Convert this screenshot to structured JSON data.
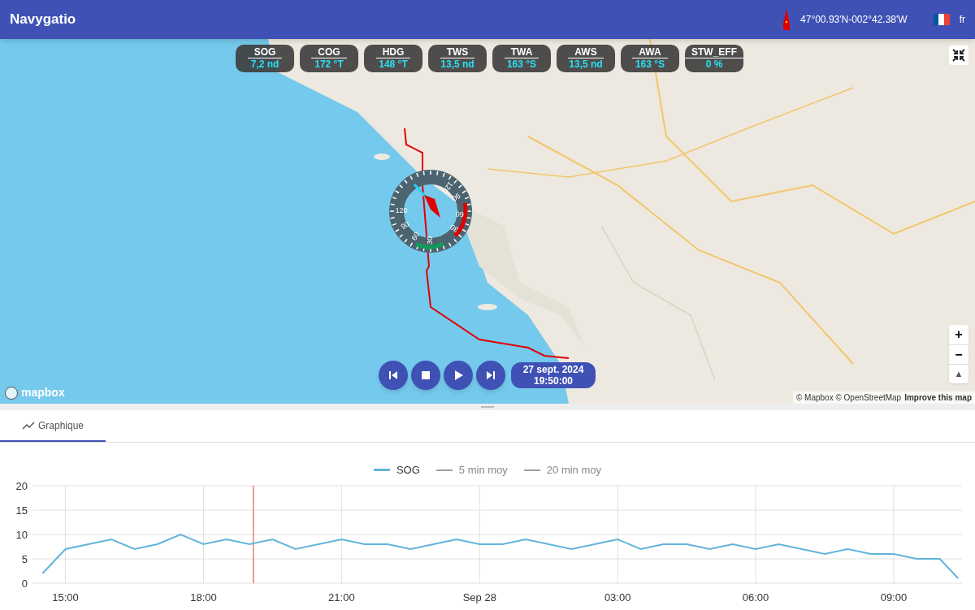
{
  "app_bar": {
    "title": "Navygatio",
    "position": "47°00.93'N-002°42.38'W",
    "language": "fr"
  },
  "instruments": [
    {
      "label": "SOG",
      "value": "7,2 nd"
    },
    {
      "label": "COG",
      "value": "172 °T"
    },
    {
      "label": "HDG",
      "value": "148 °T"
    },
    {
      "label": "TWS",
      "value": "13,5 nd"
    },
    {
      "label": "TWA",
      "value": "163 °S"
    },
    {
      "label": "AWS",
      "value": "13,5 nd"
    },
    {
      "label": "AWA",
      "value": "163 °S"
    },
    {
      "label": "STW_EFF",
      "value": "0 %"
    }
  ],
  "compass": {
    "labels": [
      "120",
      "90",
      "60",
      "30",
      "30",
      "60",
      "90",
      "120"
    ]
  },
  "map_controls": {
    "zoom_in": "+",
    "zoom_out": "−",
    "compass": "▲"
  },
  "playback": {
    "date": "27 sept. 2024",
    "time": "19:50:00"
  },
  "map_footer": {
    "logo": "mapbox",
    "attribution": "© Mapbox © OpenStreetMap",
    "improve": "Improve this map"
  },
  "tabs": [
    {
      "label": "Graphique",
      "selected": true
    }
  ],
  "chart_data": {
    "type": "line",
    "ylim": [
      0,
      20
    ],
    "yticks": [
      0,
      5,
      10,
      15,
      20
    ],
    "grid": true,
    "xlim": [
      "2024-09-27T14:17",
      "2024-09-28T10:28"
    ],
    "x": [
      "2024-09-27T14:30",
      "2024-09-27T15:00",
      "2024-09-27T15:30",
      "2024-09-27T16:00",
      "2024-09-27T16:30",
      "2024-09-27T17:00",
      "2024-09-27T17:30",
      "2024-09-27T18:00",
      "2024-09-27T18:30",
      "2024-09-27T19:00",
      "2024-09-27T19:30",
      "2024-09-27T20:00",
      "2024-09-27T20:30",
      "2024-09-27T21:00",
      "2024-09-27T21:30",
      "2024-09-27T22:00",
      "2024-09-27T22:30",
      "2024-09-27T23:00",
      "2024-09-27T23:30",
      "2024-09-28T00:00",
      "2024-09-28T00:30",
      "2024-09-28T01:00",
      "2024-09-28T01:30",
      "2024-09-28T02:00",
      "2024-09-28T02:30",
      "2024-09-28T03:00",
      "2024-09-28T03:30",
      "2024-09-28T04:00",
      "2024-09-28T04:30",
      "2024-09-28T05:00",
      "2024-09-28T05:30",
      "2024-09-28T06:00",
      "2024-09-28T06:30",
      "2024-09-28T07:00",
      "2024-09-28T07:30",
      "2024-09-28T08:00",
      "2024-09-28T08:30",
      "2024-09-28T09:00",
      "2024-09-28T09:30",
      "2024-09-28T10:00",
      "2024-09-28T10:24"
    ],
    "xticks": [
      {
        "value": "2024-09-27T15:00",
        "label": "15:00"
      },
      {
        "value": "2024-09-27T18:00",
        "label": "18:00"
      },
      {
        "value": "2024-09-27T21:00",
        "label": "21:00"
      },
      {
        "value": "2024-09-28T00:00",
        "label": "Sep 28"
      },
      {
        "value": "2024-09-28T03:00",
        "label": "03:00"
      },
      {
        "value": "2024-09-28T06:00",
        "label": "06:00"
      },
      {
        "value": "2024-09-28T09:00",
        "label": "09:00"
      }
    ],
    "series": [
      {
        "name": "SOG",
        "color": "#62b4db",
        "values": [
          2,
          7,
          8,
          9,
          7,
          8,
          10,
          8,
          9,
          8,
          9,
          7,
          8,
          9,
          8,
          8,
          7,
          8,
          9,
          8,
          8,
          9,
          8,
          7,
          8,
          9,
          7,
          8,
          8,
          7,
          8,
          7,
          8,
          7,
          6,
          7,
          6,
          6,
          5,
          5,
          1
        ]
      },
      {
        "name": "5 min moy",
        "color": "#9e9e9e",
        "values": [
          null,
          null,
          null,
          null,
          null,
          null,
          null,
          null,
          null,
          null,
          null,
          null,
          null,
          null,
          null,
          null,
          null,
          null,
          null,
          null,
          null,
          null,
          null,
          null,
          null,
          null,
          null,
          null,
          null,
          null,
          null,
          null,
          null,
          null,
          null,
          null,
          null,
          null,
          null,
          null,
          null
        ]
      },
      {
        "name": "20 min moy",
        "color": "#9e9e9e",
        "values": [
          null,
          null,
          null,
          null,
          null,
          null,
          null,
          null,
          null,
          null,
          null,
          null,
          null,
          null,
          null,
          null,
          null,
          null,
          null,
          null,
          null,
          null,
          null,
          null,
          null,
          null,
          null,
          null,
          null,
          null,
          null,
          null,
          null,
          null,
          null,
          null,
          null,
          null,
          null,
          null,
          null
        ]
      }
    ],
    "ref_lines": [
      {
        "axis": "x",
        "value": "2024-09-27T19:05",
        "color": "#e53935"
      }
    ]
  }
}
